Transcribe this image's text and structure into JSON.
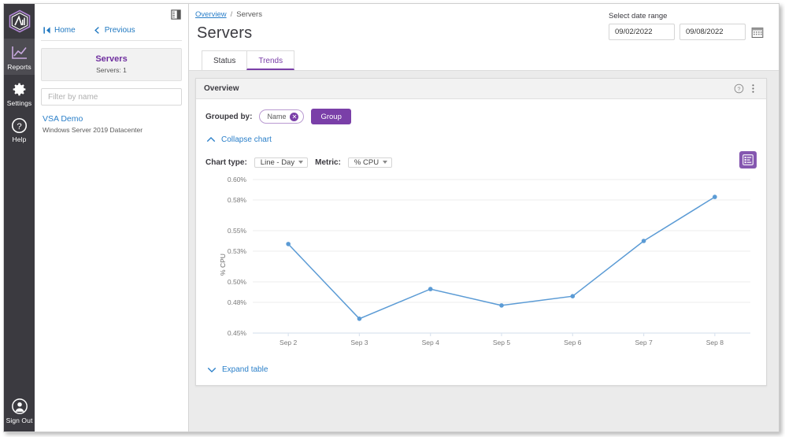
{
  "rail": {
    "logo_icon": "app-logo-icon",
    "items": [
      {
        "label": "Reports",
        "icon": "chart-line-icon",
        "active": true
      },
      {
        "label": "Settings",
        "icon": "gear-icon",
        "active": false
      },
      {
        "label": "Help",
        "icon": "question-circle-icon",
        "active": false
      }
    ],
    "signout": {
      "label": "Sign Out",
      "icon": "user-circle-icon"
    }
  },
  "context_panel": {
    "toggle_icon": "panel-collapse-icon",
    "nav": {
      "home": "Home",
      "previous": "Previous",
      "home_icon": "skip-back-icon",
      "previous_icon": "chevron-left-icon"
    },
    "card": {
      "title": "Servers",
      "subtitle": "Servers: 1"
    },
    "filter": {
      "placeholder": "Filter by name",
      "value": ""
    },
    "items": [
      {
        "name": "VSA Demo",
        "description": "Windows Server 2019 Datacenter"
      }
    ]
  },
  "header": {
    "breadcrumb": {
      "root": "Overview",
      "separator": "/",
      "current": "Servers"
    },
    "title": "Servers",
    "date_range": {
      "label": "Select date range",
      "start": "09/02/2022",
      "end": "09/08/2022",
      "calendar_icon": "calendar-icon"
    }
  },
  "tabs": [
    {
      "label": "Status",
      "active": false
    },
    {
      "label": "Trends",
      "active": true
    }
  ],
  "panel": {
    "title": "Overview",
    "help_icon": "help-circle-icon",
    "menu_icon": "kebab-menu-icon",
    "grouped_by": {
      "label": "Grouped by:",
      "chip": "Name",
      "chip_remove_icon": "close-circle-icon",
      "group_button": "Group"
    },
    "collapse_chart": {
      "label": "Collapse chart",
      "icon": "chevron-up-icon"
    },
    "chart_type": {
      "label": "Chart type:",
      "value": "Line - Day"
    },
    "metric": {
      "label": "Metric:",
      "value": "% CPU"
    },
    "list_view_icon": "list-view-icon",
    "expand_table": {
      "label": "Expand table",
      "icon": "chevron-down-icon"
    }
  },
  "colors": {
    "brand_purple": "#7a3fa8",
    "link_blue": "#2a7fc9",
    "series_blue": "#5b9bd5",
    "rail_dark": "#3b3a40",
    "content_bg": "#ebebeb"
  },
  "chart_data": {
    "type": "line",
    "title": "",
    "xlabel": "",
    "ylabel": "% CPU",
    "categories": [
      "Sep 2",
      "Sep 3",
      "Sep 4",
      "Sep 5",
      "Sep 6",
      "Sep 7",
      "Sep 8"
    ],
    "values": [
      0.537,
      0.464,
      0.493,
      0.477,
      0.486,
      0.54,
      0.583
    ],
    "series": [
      {
        "name": "VSA Demo",
        "values": [
          0.537,
          0.464,
          0.493,
          0.477,
          0.486,
          0.54,
          0.583
        ]
      }
    ],
    "ytick_labels": [
      "0.60%",
      "0.58%",
      "0.55%",
      "0.53%",
      "0.50%",
      "0.48%",
      "0.45%"
    ],
    "ytick_values": [
      0.6,
      0.58,
      0.55,
      0.53,
      0.5,
      0.48,
      0.45
    ],
    "ylim": [
      0.45,
      0.6
    ],
    "grid": true,
    "legend": "none",
    "unit": "%"
  }
}
